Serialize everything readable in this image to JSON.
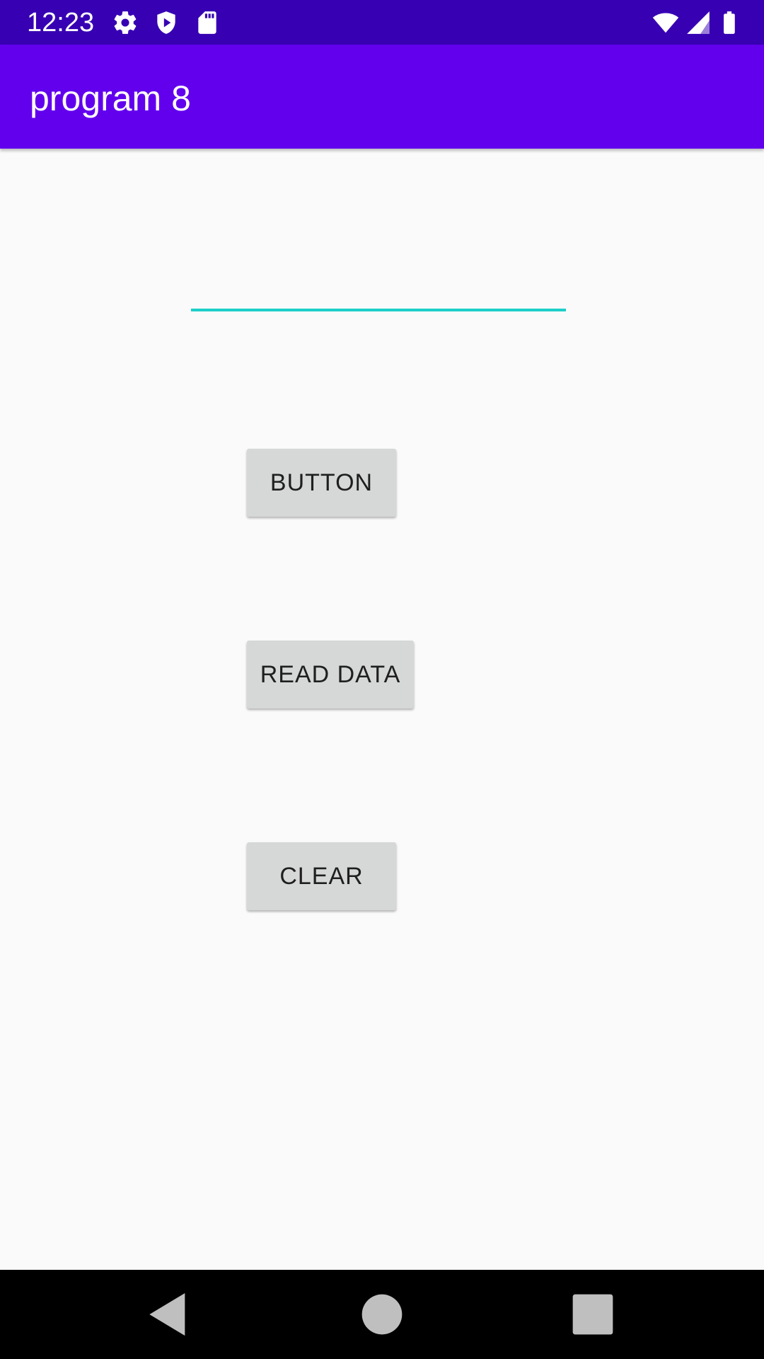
{
  "status_bar": {
    "time": "12:23",
    "icons": [
      "settings-icon",
      "shield-icon",
      "sd-card-icon",
      "wifi-icon",
      "signal-icon",
      "battery-icon"
    ]
  },
  "app_bar": {
    "title": "program 8"
  },
  "text_field": {
    "value": "",
    "placeholder": ""
  },
  "buttons": {
    "button_label": "BUTTON",
    "read_data_label": "READ DATA",
    "clear_label": "CLEAR"
  },
  "nav_bar": {
    "icons": [
      "back-icon",
      "home-icon",
      "recents-icon"
    ]
  },
  "colors": {
    "status_bar": "#3700b3",
    "app_bar": "#6200ee",
    "accent": "#1ccfc9",
    "button_bg": "#d6d7d7",
    "background": "#fafafa"
  }
}
